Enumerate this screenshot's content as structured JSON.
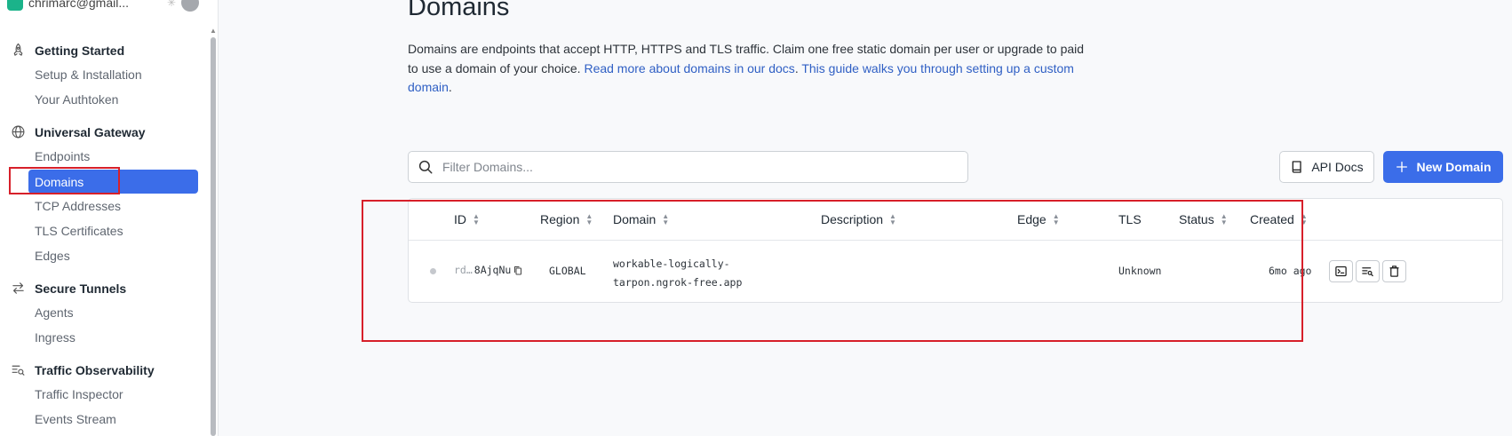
{
  "sidebar": {
    "account_name": "chrimarc@gmail...",
    "sections": [
      {
        "title": "Getting Started",
        "icon": "rocket-icon",
        "items": [
          "Setup & Installation",
          "Your Authtoken"
        ]
      },
      {
        "title": "Universal Gateway",
        "icon": "globe-icon",
        "items": [
          "Endpoints",
          "Domains",
          "TCP Addresses",
          "TLS Certificates",
          "Edges"
        ]
      },
      {
        "title": "Secure Tunnels",
        "icon": "arrows-swap-icon",
        "items": [
          "Agents",
          "Ingress"
        ]
      },
      {
        "title": "Traffic Observability",
        "icon": "list-search-icon",
        "items": [
          "Traffic Inspector",
          "Events Stream"
        ]
      }
    ],
    "active_item": "Domains"
  },
  "page": {
    "title": "Domains",
    "description_text": "Domains are endpoints that accept HTTP, HTTPS and TLS traffic. Claim one free static domain per user or upgrade to paid to use a domain of your choice. ",
    "link_docs": "Read more about domains in our docs",
    "link_guide": "This guide walks you through setting up a custom domain",
    "period": ".",
    "filter_placeholder": "Filter Domains...",
    "api_docs_label": "API Docs",
    "new_domain_label": "New Domain"
  },
  "table": {
    "headers": [
      "ID",
      "Region",
      "Domain",
      "Description",
      "Edge",
      "TLS",
      "Status",
      "Created"
    ],
    "rows": [
      {
        "id_prefix": "rd…",
        "id_suffix": "8AjqNu",
        "region": "GLOBAL",
        "domain_line1": "workable-logically-",
        "domain_line2": "tarpon.ngrok-free.app",
        "description": "",
        "edge": "",
        "tls": "Unknown",
        "status": "",
        "created": "6mo ago"
      }
    ]
  },
  "colors": {
    "accent": "#3b6de9",
    "annotation_red": "#d7202a",
    "link": "#2f5fc4"
  }
}
